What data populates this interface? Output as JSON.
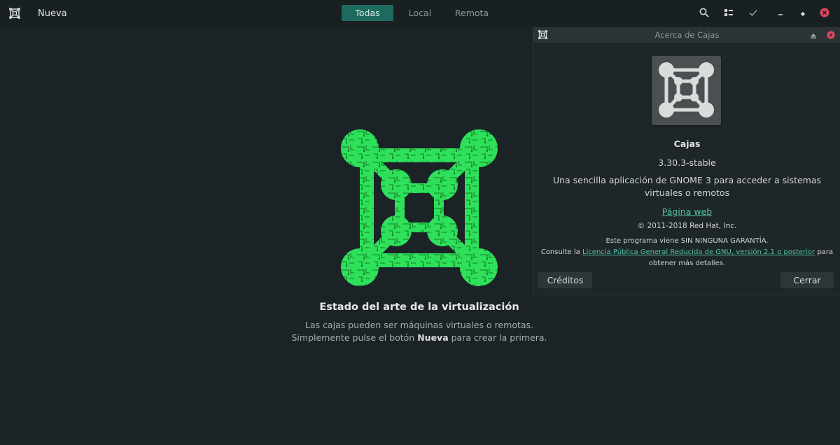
{
  "header": {
    "new_label": "Nueva",
    "tabs": [
      {
        "label": "Todas",
        "active": true
      },
      {
        "label": "Local",
        "active": false
      },
      {
        "label": "Remota",
        "active": false
      }
    ],
    "icons": [
      "search-icon",
      "view-toggle-icon",
      "select-check-icon",
      "minimize-icon",
      "maximize-icon",
      "close-icon"
    ]
  },
  "empty_state": {
    "title": "Estado del arte de la virtualización",
    "line1": "Las cajas pueden ser máquinas virtuales o remotas.",
    "line2_before": "Simplemente pulse el botón ",
    "line2_bold": "Nueva",
    "line2_after": " para crear la primera."
  },
  "about_dialog": {
    "title": "Acerca de Cajas",
    "app_name": "Cajas",
    "version": "3.30.3-stable",
    "description": "Una sencilla aplicación de GNOME 3 para acceder a sistemas virtuales o remotos",
    "website_label": "Página web",
    "copyright": "© 2011-2018 Red Hat, Inc.",
    "warranty": "Este programa viene SIN NINGUNA GARANTÍA.",
    "license_before": "Consulte la ",
    "license_link": "Licencia Pública General Reducida de GNU, versión 2.1 o posterior",
    "license_after": " para",
    "license_line2": "obtener más detalles.",
    "credits_button": "Créditos",
    "close_button": "Cerrar"
  },
  "colors": {
    "background": "#1c2326",
    "accent": "#1f6a5e",
    "link": "#4fc1a8",
    "logo_green": "#2ee05a",
    "close_red": "#e0485e"
  }
}
